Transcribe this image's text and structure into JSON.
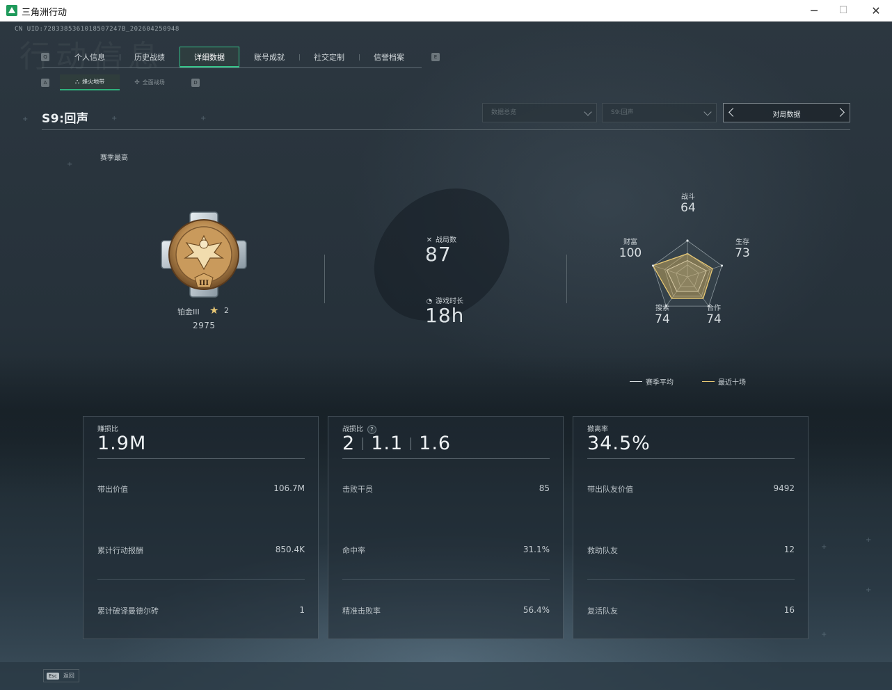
{
  "window": {
    "title": "三角洲行动",
    "min": "─",
    "max": "☐",
    "close": "✕"
  },
  "uid": "CN UID:7283385361018507247B_202604250948",
  "bg_text": "行动信息",
  "main_tabs": [
    {
      "key": "Q"
    },
    {
      "label": "个人信息"
    },
    {
      "label": "历史战绩"
    },
    {
      "label": "详细数据"
    },
    {
      "label": "账号成就"
    },
    {
      "label": "社交定制"
    },
    {
      "label": "信誉档案"
    },
    {
      "key": "E"
    }
  ],
  "main_keys": {
    "left": "Q",
    "right": "E"
  },
  "sub_tabs": [
    {
      "label": "烽火地带",
      "icon": "⛬"
    },
    {
      "label": "全面战场",
      "icon": "✢"
    }
  ],
  "sub_keys": {
    "left": "A",
    "right": "D"
  },
  "season": {
    "title": "S9:回声"
  },
  "filters": {
    "data_select": "数据总览",
    "season_select": "S9:回声",
    "pager_label": "对局数据"
  },
  "rank": {
    "section_label": "赛季最高",
    "name": "铂金III",
    "star_icon": "★",
    "stars": "2",
    "score": "2975",
    "medal_roman": "III"
  },
  "overview": {
    "games_label": "战局数",
    "games_icon": "✕",
    "games_value": "87",
    "time_label": "游戏时长",
    "time_icon": "◔",
    "time_value": "18h"
  },
  "radar": {
    "axes": [
      {
        "label": "战斗",
        "value": "64"
      },
      {
        "label": "生存",
        "value": "73"
      },
      {
        "label": "合作",
        "value": "74"
      },
      {
        "label": "搜索",
        "value": "74"
      },
      {
        "label": "财富",
        "value": "100"
      }
    ],
    "season_avg": [
      0.45,
      0.55,
      0.5,
      0.5,
      0.6
    ],
    "recent_ten": [
      0.64,
      0.73,
      0.74,
      0.74,
      1.0
    ],
    "legend": [
      {
        "label": "赛季平均",
        "color": "#d8dde0"
      },
      {
        "label": "最近十场",
        "color": "#e7c874"
      }
    ]
  },
  "cards": [
    {
      "header_label": "赚损比",
      "header_value": "1.9M",
      "rows": [
        {
          "label": "带出价值",
          "value": "106.7M"
        },
        {
          "label": "累计行动报酬",
          "value": "850.4K"
        },
        {
          "label": "累计破译曼德尔砖",
          "value": "1"
        }
      ]
    },
    {
      "header_label": "战损比",
      "help": "?",
      "kd_values": [
        "2",
        "1.1",
        "1.6"
      ],
      "rows": [
        {
          "label": "击败干员",
          "value": "85"
        },
        {
          "label": "命中率",
          "value": "31.1%"
        },
        {
          "label": "精准击败率",
          "value": "56.4%"
        }
      ]
    },
    {
      "header_label": "撤离率",
      "header_value": "34.5%",
      "rows": [
        {
          "label": "带出队友价值",
          "value": "9492"
        },
        {
          "label": "救助队友",
          "value": "12"
        },
        {
          "label": "复活队友",
          "value": "16"
        }
      ]
    }
  ],
  "footer": {
    "key": "Esc",
    "label": "返回"
  },
  "colors": {
    "accent": "#34c58a",
    "gold": "#e7c874"
  }
}
